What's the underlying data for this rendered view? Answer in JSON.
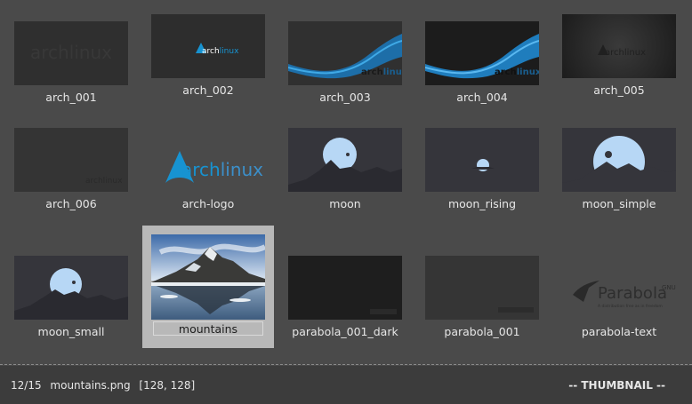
{
  "grid": {
    "items": [
      {
        "label": "arch_001"
      },
      {
        "label": "arch_002"
      },
      {
        "label": "arch_003"
      },
      {
        "label": "arch_004"
      },
      {
        "label": "arch_005"
      },
      {
        "label": "arch_006"
      },
      {
        "label": "arch-logo"
      },
      {
        "label": "moon"
      },
      {
        "label": "moon_rising"
      },
      {
        "label": "moon_simple"
      },
      {
        "label": "moon_small"
      },
      {
        "label": "mountains"
      },
      {
        "label": "parabola_001_dark"
      },
      {
        "label": "parabola_001"
      },
      {
        "label": "parabola-text"
      }
    ],
    "selected_index": 12
  },
  "thumb_text": {
    "arch_a": "arch",
    "arch_b": "linux",
    "parabola": "Parabola",
    "parabola_sup": "GNU",
    "parabola_tag": "A distribution free as in freedom"
  },
  "status": {
    "position": "12/15",
    "filename": "mountains.png",
    "dimensions": "[128, 128]",
    "mode": "-- THUMBNAIL --"
  },
  "colors": {
    "background": "#4a4a4a",
    "statusbar": "#3c3c3c",
    "selection": "#b8b8b8",
    "arch_blue": "#1793d1",
    "moon": "#b7d7f5"
  }
}
